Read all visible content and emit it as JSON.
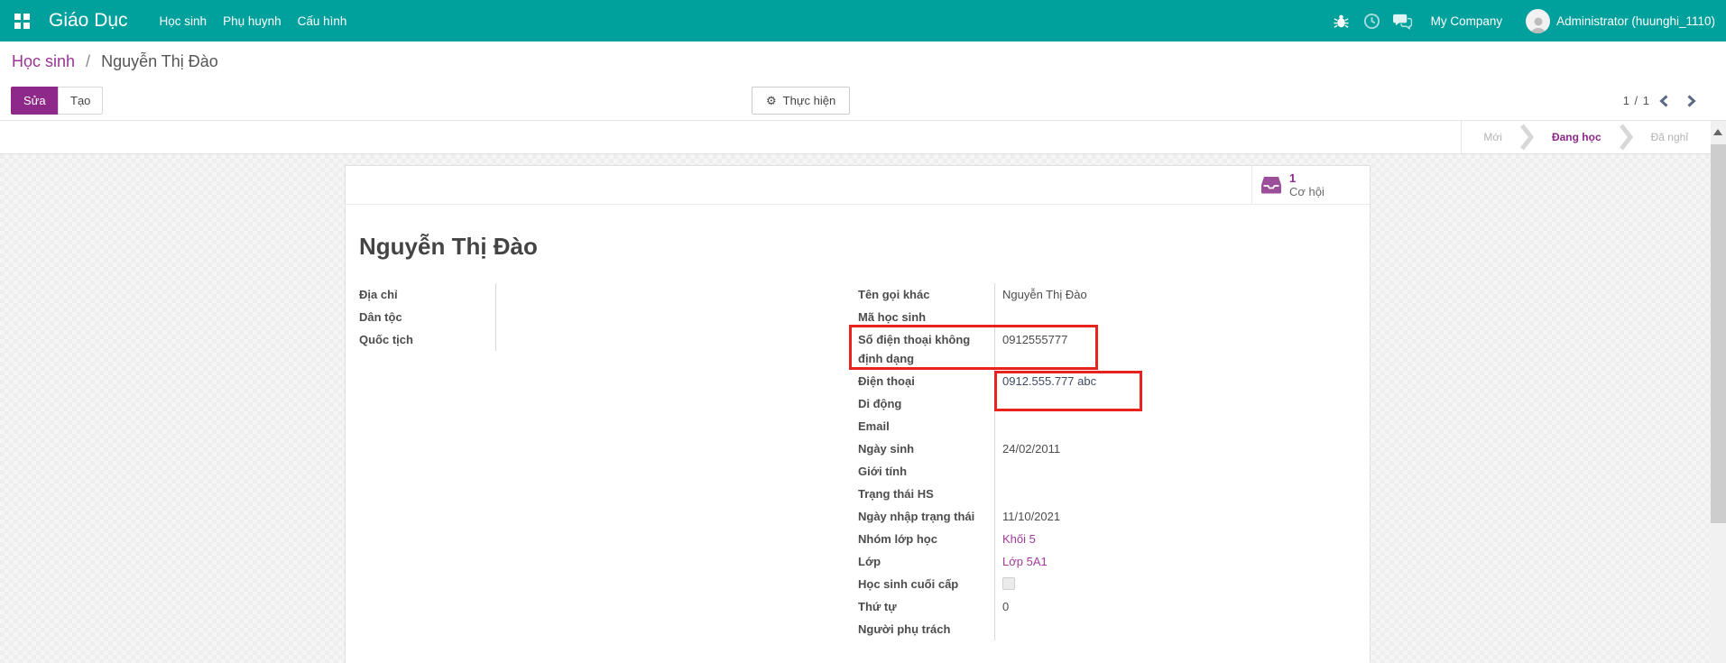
{
  "navbar": {
    "brand": "Giáo Dục",
    "menus": [
      {
        "label": "Học sinh"
      },
      {
        "label": "Phụ huynh"
      },
      {
        "label": "Cấu hình"
      }
    ],
    "company": "My Company",
    "user": "Administrator (huunghi_1110)"
  },
  "icons": {
    "apps": "apps-grid",
    "debug": "bug-icon",
    "activities": "clock-icon",
    "messages": "chat-bubbles-icon",
    "action_gear": "⚙",
    "smart_button": "inbox-icon",
    "pager_prev": "chevron-left",
    "pager_next": "chevron-right"
  },
  "breadcrumb": {
    "parent": "Học sinh",
    "separator": "/",
    "current": "Nguyễn Thị Đào"
  },
  "actions": {
    "edit": "Sửa",
    "create": "Tạo",
    "action_menu": "Thực hiện",
    "gear_glyph": "⚙"
  },
  "pager": {
    "value": "1 / 1"
  },
  "statusbar": {
    "stages": [
      {
        "label": "Mới",
        "active": false
      },
      {
        "label": "Đang học",
        "active": true
      },
      {
        "label": "Đã nghỉ",
        "active": false
      }
    ]
  },
  "smart_button": {
    "count": "1",
    "label": "Cơ hội"
  },
  "record": {
    "title": "Nguyễn Thị Đào"
  },
  "form": {
    "left_fields": [
      {
        "label": "Địa chỉ",
        "value": ""
      },
      {
        "label": "Dân tộc",
        "value": ""
      },
      {
        "label": "Quốc tịch",
        "value": ""
      }
    ],
    "right_fields": [
      {
        "label": "Tên gọi khác",
        "value": "Nguyễn Thị Đào",
        "type": "text"
      },
      {
        "label": "Mã học sinh",
        "value": "",
        "type": "text"
      },
      {
        "label": "Số điện thoại không định dạng",
        "value": "0912555777",
        "type": "text"
      },
      {
        "label": "Điện thoại",
        "value": "0912.555.777 abc",
        "type": "phone"
      },
      {
        "label": "Di động",
        "value": "",
        "type": "phone"
      },
      {
        "label": "Email",
        "value": "",
        "type": "email"
      },
      {
        "label": "Ngày sinh",
        "value": "24/02/2011",
        "type": "date"
      },
      {
        "label": "Giới tính",
        "value": "",
        "type": "text"
      },
      {
        "label": "Trạng thái HS",
        "value": "",
        "type": "text"
      },
      {
        "label": "Ngày nhập trạng thái",
        "value": "11/10/2021",
        "type": "date"
      },
      {
        "label": "Nhóm lớp học",
        "value": "Khối 5",
        "type": "link"
      },
      {
        "label": "Lớp",
        "value": "Lớp 5A1",
        "type": "link"
      },
      {
        "label": "Học sinh cuối cấp",
        "value": "",
        "type": "checkbox",
        "checked": false
      },
      {
        "label": "Thứ tự",
        "value": "0",
        "type": "text"
      },
      {
        "label": "Người phụ trách",
        "value": "",
        "type": "text"
      }
    ]
  },
  "colors": {
    "navbar": "#00a09d",
    "primary": "#8e2889",
    "link": "#a03a99",
    "annotation": "#e8221c",
    "text": "#4c4c4c",
    "muted": "#b3b3b3"
  }
}
